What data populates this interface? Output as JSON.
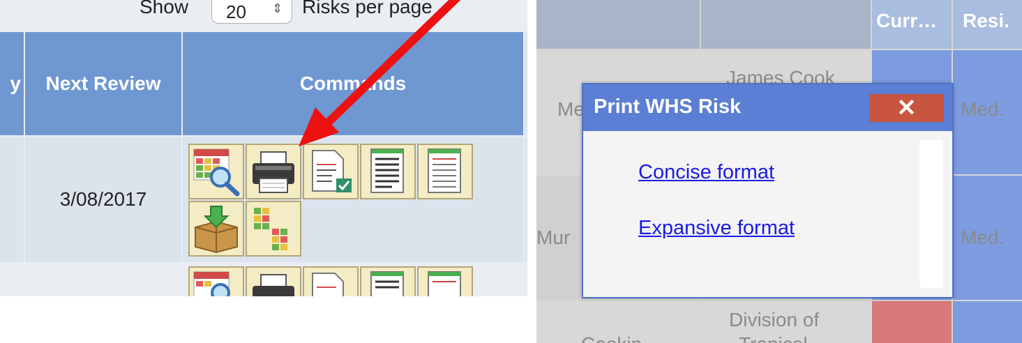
{
  "left_panel": {
    "show_label": "Show",
    "page_size_value": "20",
    "page_size_suffix": "Risks per page",
    "columns": [
      "y",
      "Next Review",
      "Commands"
    ],
    "rows": [
      {
        "next_review": "3/08/2017",
        "command_icons": [
          "view-risk-icon",
          "print-icon",
          "checklist-icon",
          "document-icon",
          "list-document-icon",
          "archive-box-icon",
          "matrix-copy-icon"
        ]
      },
      {
        "next_review": "",
        "command_icons": [
          "view-risk-icon",
          "print-icon",
          "checklist-icon",
          "document-icon",
          "list-document-icon"
        ]
      }
    ],
    "annotation": "red-arrow-pointing-to-print-icon"
  },
  "right_panel": {
    "headers": [
      "",
      "",
      "Curr…",
      "Resi."
    ],
    "rows": [
      {
        "col1": "Me",
        "col2": "James Cook",
        "current": "",
        "residual": "Med."
      },
      {
        "col1": "Mur",
        "col2": "",
        "current": "",
        "residual": "Med."
      },
      {
        "col1": "Cookin",
        "col2": "Division of",
        "col2_line2": "Tropical",
        "current": "",
        "residual": ""
      }
    ],
    "dialog": {
      "title": "Print WHS Risk",
      "close_label": "✕",
      "links": [
        "Concise format",
        "Expansive format"
      ]
    }
  },
  "colors": {
    "header_blue": "#6f97d2",
    "dialog_title_blue": "#5a7fd4",
    "close_red": "#c8553f",
    "link_blue": "#1a1ae6",
    "arrow_red": "#ee1111",
    "high_risk_pink": "#d97a7a"
  }
}
